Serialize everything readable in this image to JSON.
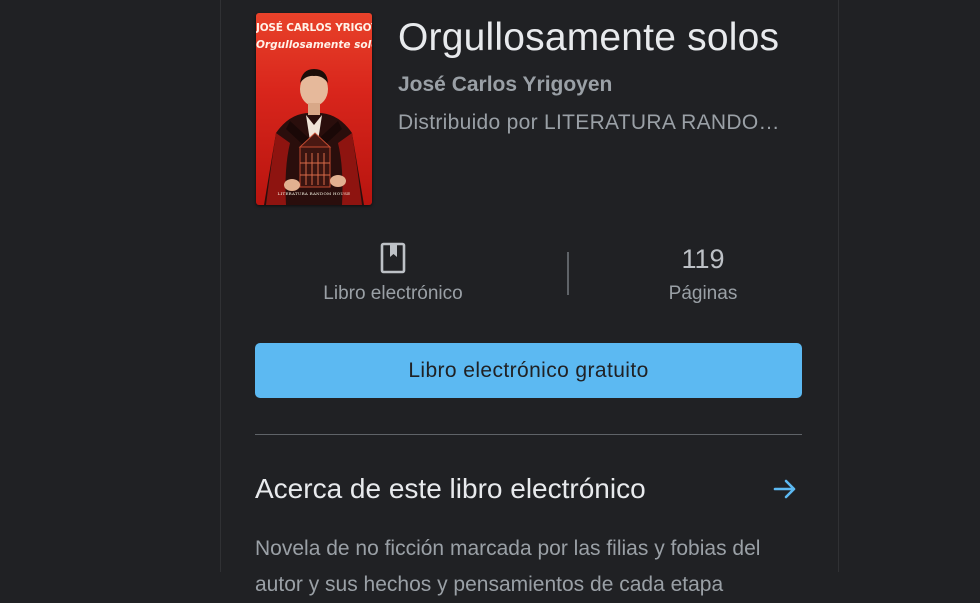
{
  "book": {
    "cover": {
      "author_text": "JOSÉ CARLOS YRIGOYEN",
      "title_text": "Orgullosamente solos",
      "publisher_text": "LITERATURA RANDOM HOUSE"
    },
    "title": "Orgullosamente solos",
    "author": "José Carlos Yrigoyen",
    "distributor": "Distribuido por LITERATURA RANDO…"
  },
  "stats": {
    "format_icon": "bookmark-book-icon",
    "format_label": "Libro electrónico",
    "pages_value": "119",
    "pages_label": "Páginas"
  },
  "cta": {
    "label": "Libro electrónico gratuito",
    "color": "#5cb9f2"
  },
  "about": {
    "title": "Acerca de este libro electrónico",
    "arrow_icon": "arrow-right-icon",
    "arrow_color": "#5cb9f2",
    "description": "Novela de no ficción marcada por las filias y fobias del autor y sus hechos y pensamientos de cada etapa"
  },
  "colors": {
    "background": "#202124",
    "text_primary": "#e8eaed",
    "text_secondary": "#9aa0a6",
    "divider": "#5f6368"
  }
}
